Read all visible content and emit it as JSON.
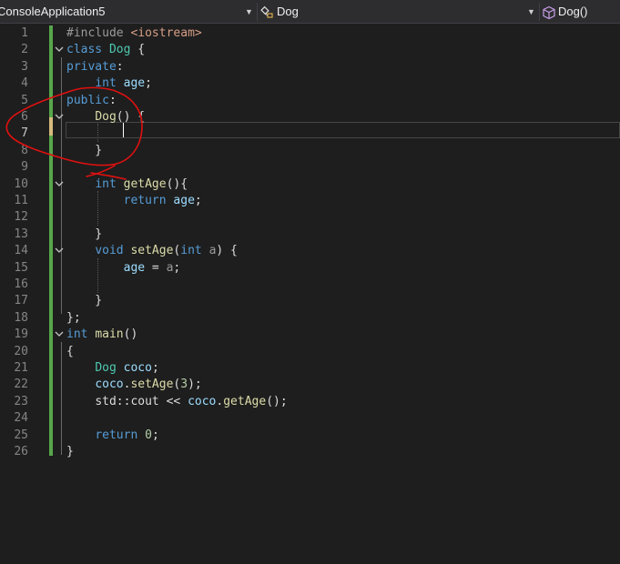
{
  "navbar": {
    "project": "ConsoleApplication5",
    "class_scope": "Dog",
    "member_scope": "Dog()"
  },
  "editor": {
    "active_line": 7,
    "lines": [
      {
        "n": "1",
        "tokens": [
          {
            "t": "#include ",
            "c": "pp"
          },
          {
            "t": "<iostream>",
            "c": "str"
          }
        ]
      },
      {
        "n": "2",
        "tokens": [
          {
            "t": "class ",
            "c": "kw"
          },
          {
            "t": "Dog",
            "c": "type"
          },
          {
            "t": " {",
            "c": "plain"
          }
        ]
      },
      {
        "n": "3",
        "tokens": [
          {
            "t": "private",
            "c": "kw"
          },
          {
            "t": ":",
            "c": "plain"
          }
        ]
      },
      {
        "n": "4",
        "tokens": [
          {
            "t": "    ",
            "c": "plain"
          },
          {
            "t": "int",
            "c": "kw"
          },
          {
            "t": " ",
            "c": "plain"
          },
          {
            "t": "age",
            "c": "var"
          },
          {
            "t": ";",
            "c": "plain"
          }
        ]
      },
      {
        "n": "5",
        "tokens": [
          {
            "t": "public",
            "c": "kw"
          },
          {
            "t": ":",
            "c": "plain"
          }
        ]
      },
      {
        "n": "6",
        "tokens": [
          {
            "t": "    ",
            "c": "plain"
          },
          {
            "t": "Dog",
            "c": "func"
          },
          {
            "t": "() {",
            "c": "plain"
          }
        ]
      },
      {
        "n": "7",
        "tokens": []
      },
      {
        "n": "8",
        "tokens": [
          {
            "t": "    }",
            "c": "plain"
          }
        ]
      },
      {
        "n": "9",
        "tokens": []
      },
      {
        "n": "10",
        "tokens": [
          {
            "t": "    ",
            "c": "plain"
          },
          {
            "t": "int",
            "c": "kw"
          },
          {
            "t": " ",
            "c": "plain"
          },
          {
            "t": "getAge",
            "c": "func"
          },
          {
            "t": "(){",
            "c": "plain"
          }
        ]
      },
      {
        "n": "11",
        "tokens": [
          {
            "t": "        ",
            "c": "plain"
          },
          {
            "t": "return",
            "c": "kw"
          },
          {
            "t": " ",
            "c": "plain"
          },
          {
            "t": "age",
            "c": "var"
          },
          {
            "t": ";",
            "c": "plain"
          }
        ]
      },
      {
        "n": "12",
        "tokens": []
      },
      {
        "n": "13",
        "tokens": [
          {
            "t": "    }",
            "c": "plain"
          }
        ]
      },
      {
        "n": "14",
        "tokens": [
          {
            "t": "    ",
            "c": "plain"
          },
          {
            "t": "void",
            "c": "kw"
          },
          {
            "t": " ",
            "c": "plain"
          },
          {
            "t": "setAge",
            "c": "func"
          },
          {
            "t": "(",
            "c": "plain"
          },
          {
            "t": "int",
            "c": "kw"
          },
          {
            "t": " ",
            "c": "plain"
          },
          {
            "t": "a",
            "c": "param"
          },
          {
            "t": ") {",
            "c": "plain"
          }
        ]
      },
      {
        "n": "15",
        "tokens": [
          {
            "t": "        ",
            "c": "plain"
          },
          {
            "t": "age",
            "c": "var"
          },
          {
            "t": " = ",
            "c": "plain"
          },
          {
            "t": "a",
            "c": "param"
          },
          {
            "t": ";",
            "c": "plain"
          }
        ]
      },
      {
        "n": "16",
        "tokens": []
      },
      {
        "n": "17",
        "tokens": [
          {
            "t": "    }",
            "c": "plain"
          }
        ]
      },
      {
        "n": "18",
        "tokens": [
          {
            "t": "};",
            "c": "plain"
          }
        ]
      },
      {
        "n": "19",
        "tokens": [
          {
            "t": "int",
            "c": "kw"
          },
          {
            "t": " ",
            "c": "plain"
          },
          {
            "t": "main",
            "c": "func"
          },
          {
            "t": "()",
            "c": "plain"
          }
        ]
      },
      {
        "n": "20",
        "tokens": [
          {
            "t": "{",
            "c": "plain"
          }
        ]
      },
      {
        "n": "21",
        "tokens": [
          {
            "t": "    ",
            "c": "plain"
          },
          {
            "t": "Dog",
            "c": "type"
          },
          {
            "t": " ",
            "c": "plain"
          },
          {
            "t": "coco",
            "c": "var"
          },
          {
            "t": ";",
            "c": "plain"
          }
        ]
      },
      {
        "n": "22",
        "tokens": [
          {
            "t": "    ",
            "c": "plain"
          },
          {
            "t": "coco",
            "c": "var"
          },
          {
            "t": ".",
            "c": "plain"
          },
          {
            "t": "setAge",
            "c": "func"
          },
          {
            "t": "(",
            "c": "plain"
          },
          {
            "t": "3",
            "c": "num"
          },
          {
            "t": ");",
            "c": "plain"
          }
        ]
      },
      {
        "n": "23",
        "tokens": [
          {
            "t": "    ",
            "c": "plain"
          },
          {
            "t": "std",
            "c": "plain"
          },
          {
            "t": "::",
            "c": "plain"
          },
          {
            "t": "cout",
            "c": "plain"
          },
          {
            "t": " << ",
            "c": "plain"
          },
          {
            "t": "coco",
            "c": "var"
          },
          {
            "t": ".",
            "c": "plain"
          },
          {
            "t": "getAge",
            "c": "func"
          },
          {
            "t": "();",
            "c": "plain"
          }
        ]
      },
      {
        "n": "24",
        "tokens": []
      },
      {
        "n": "25",
        "tokens": [
          {
            "t": "    ",
            "c": "plain"
          },
          {
            "t": "return",
            "c": "kw"
          },
          {
            "t": " ",
            "c": "plain"
          },
          {
            "t": "0",
            "c": "num"
          },
          {
            "t": ";",
            "c": "plain"
          }
        ]
      },
      {
        "n": "26",
        "tokens": [
          {
            "t": "}",
            "c": "plain"
          }
        ]
      }
    ],
    "fold_lines": [
      "2",
      "6",
      "10",
      "14",
      "19"
    ]
  },
  "annotation": {
    "color": "#e01010"
  },
  "icons": {
    "dropdown": "chevron-down-icon",
    "class_scope": "class-scope-icon",
    "member_scope": "method-cube-icon"
  }
}
